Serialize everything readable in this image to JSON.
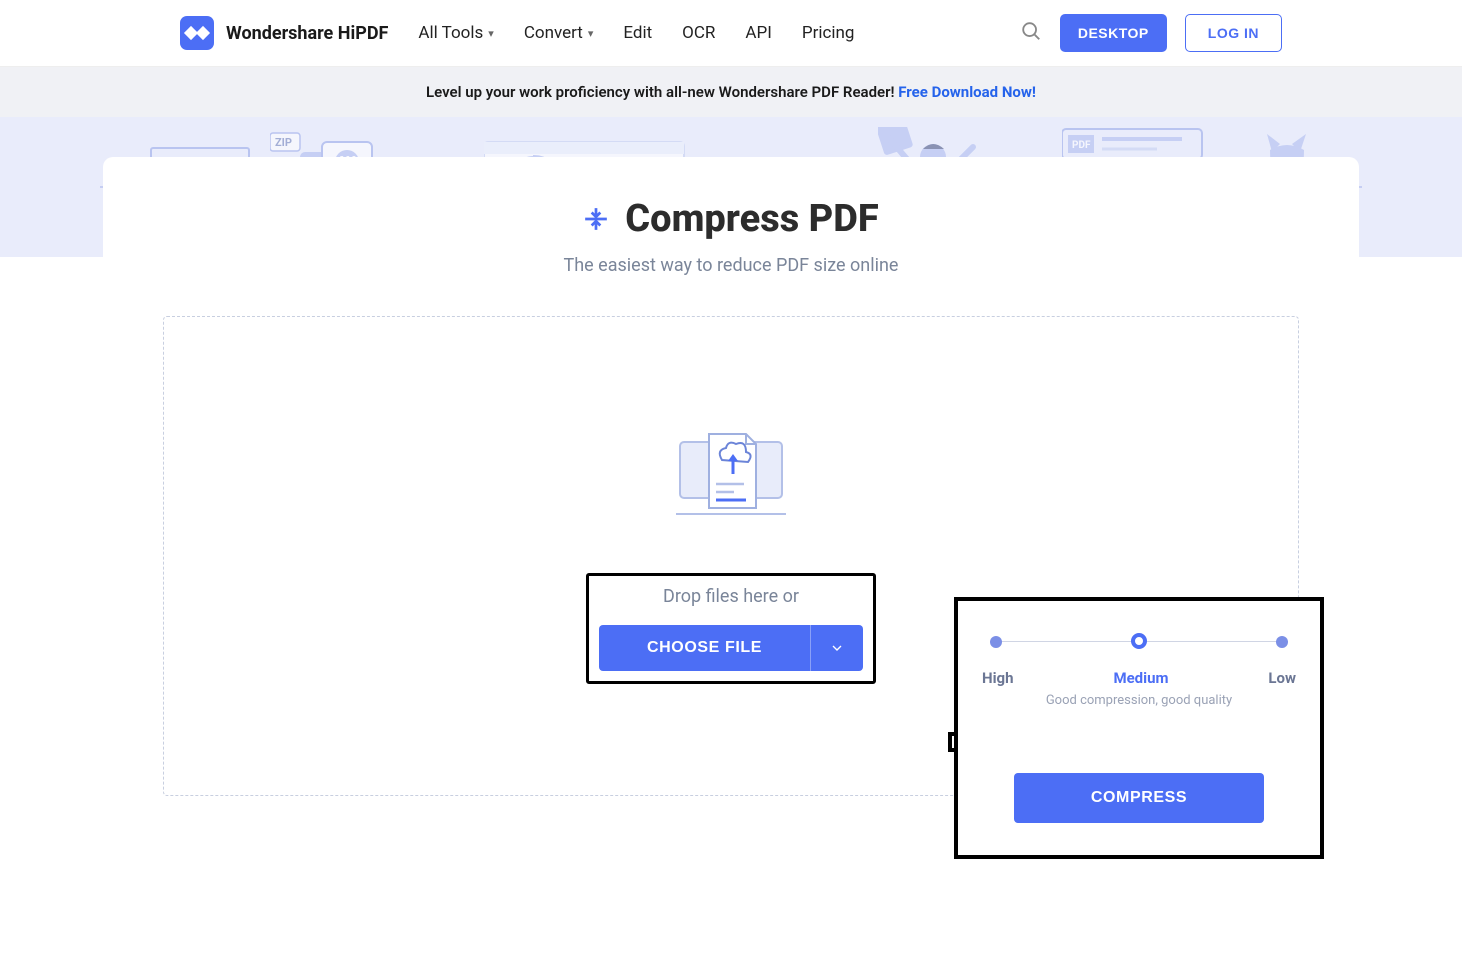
{
  "header": {
    "brand": "Wondershare HiPDF",
    "nav": {
      "all_tools": "All Tools",
      "convert": "Convert",
      "edit": "Edit",
      "ocr": "OCR",
      "api": "API",
      "pricing": "Pricing"
    },
    "desktop_btn": "DESKTOP",
    "login_btn": "LOG IN"
  },
  "promo": {
    "text": "Level up your work proficiency with all-new Wondershare PDF Reader! ",
    "link_text": "Free Download Now!"
  },
  "main": {
    "title": "Compress PDF",
    "subtitle": "The easiest way to reduce PDF size online",
    "drop_text": "Drop files here or",
    "choose_file_btn": "CHOOSE FILE"
  },
  "panel": {
    "labels": {
      "high": "High",
      "medium": "Medium",
      "low": "Low"
    },
    "desc": "Good compression, good quality",
    "compress_btn": "COMPRESS"
  }
}
